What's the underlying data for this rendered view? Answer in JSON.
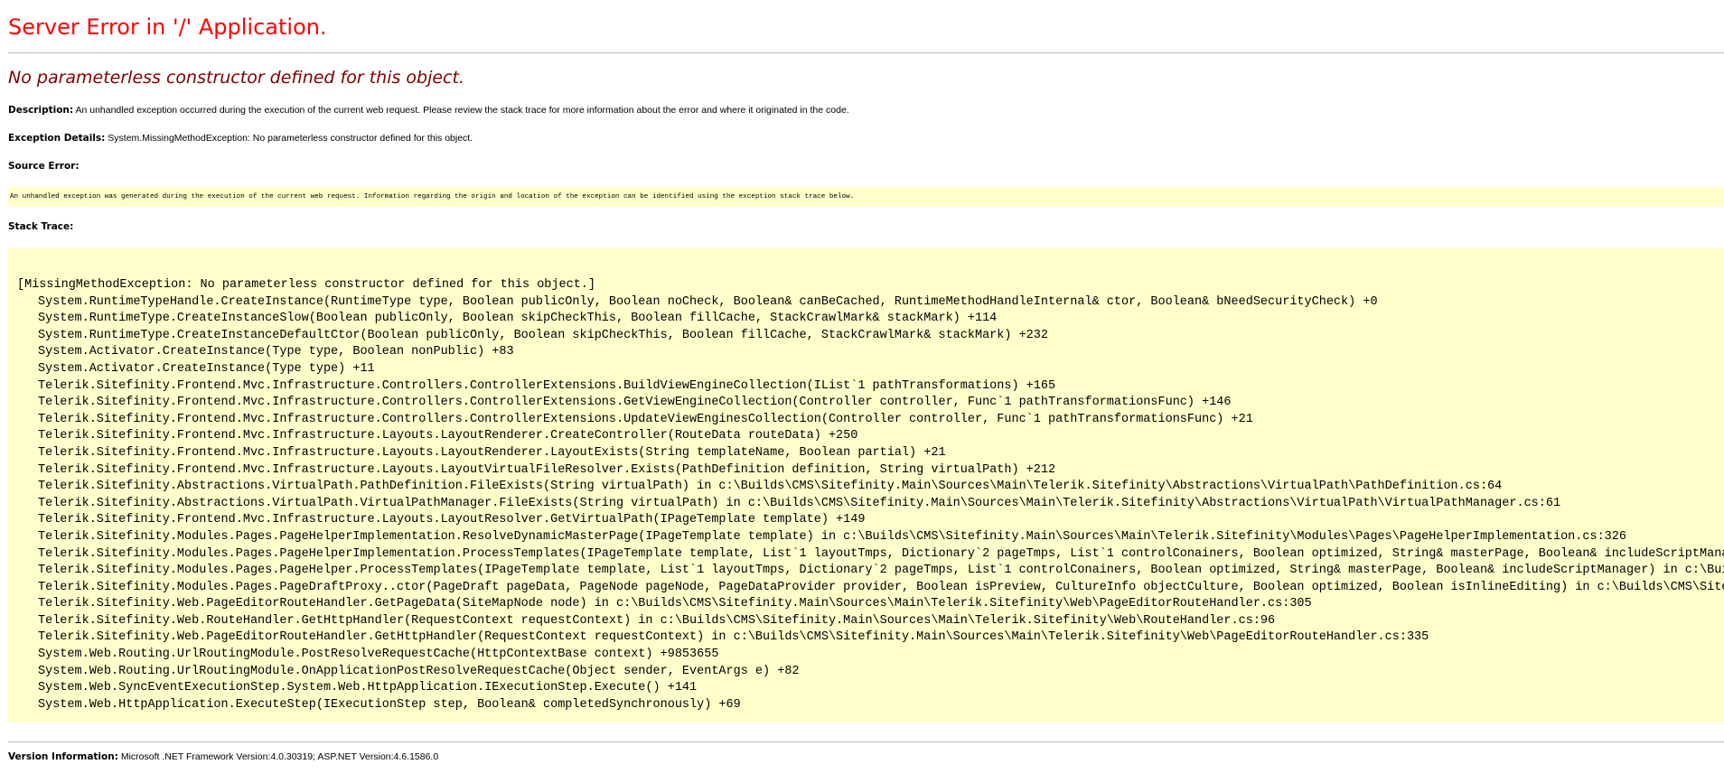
{
  "title": "Server Error in '/' Application.",
  "message": "No parameterless constructor defined for this object.",
  "description": {
    "label": "Description:",
    "text": " An unhandled exception occurred during the execution of the current web request. Please review the stack trace for more information about the error and where it originated in the code."
  },
  "exception_details": {
    "label": "Exception Details:",
    "text": " System.MissingMethodException: No parameterless constructor defined for this object."
  },
  "source_error": {
    "label": "Source Error:",
    "text": "An unhandled exception was generated during the execution of the current web request. Information regarding the origin and location of the exception can be identified using the exception stack trace below."
  },
  "stack_trace": {
    "label": "Stack Trace:",
    "header": "[MissingMethodException: No parameterless constructor defined for this object.]",
    "lines": [
      "System.RuntimeTypeHandle.CreateInstance(RuntimeType type, Boolean publicOnly, Boolean noCheck, Boolean& canBeCached, RuntimeMethodHandleInternal& ctor, Boolean& bNeedSecurityCheck) +0",
      "System.RuntimeType.CreateInstanceSlow(Boolean publicOnly, Boolean skipCheckThis, Boolean fillCache, StackCrawlMark& stackMark) +114",
      "System.RuntimeType.CreateInstanceDefaultCtor(Boolean publicOnly, Boolean skipCheckThis, Boolean fillCache, StackCrawlMark& stackMark) +232",
      "System.Activator.CreateInstance(Type type, Boolean nonPublic) +83",
      "System.Activator.CreateInstance(Type type) +11",
      "Telerik.Sitefinity.Frontend.Mvc.Infrastructure.Controllers.ControllerExtensions.BuildViewEngineCollection(IList`1 pathTransformations) +165",
      "Telerik.Sitefinity.Frontend.Mvc.Infrastructure.Controllers.ControllerExtensions.GetViewEngineCollection(Controller controller, Func`1 pathTransformationsFunc) +146",
      "Telerik.Sitefinity.Frontend.Mvc.Infrastructure.Controllers.ControllerExtensions.UpdateViewEnginesCollection(Controller controller, Func`1 pathTransformationsFunc) +21",
      "Telerik.Sitefinity.Frontend.Mvc.Infrastructure.Layouts.LayoutRenderer.CreateController(RouteData routeData) +250",
      "Telerik.Sitefinity.Frontend.Mvc.Infrastructure.Layouts.LayoutRenderer.LayoutExists(String templateName, Boolean partial) +21",
      "Telerik.Sitefinity.Frontend.Mvc.Infrastructure.Layouts.LayoutVirtualFileResolver.Exists(PathDefinition definition, String virtualPath) +212",
      "Telerik.Sitefinity.Abstractions.VirtualPath.PathDefinition.FileExists(String virtualPath) in c:\\Builds\\CMS\\Sitefinity.Main\\Sources\\Main\\Telerik.Sitefinity\\Abstractions\\VirtualPath\\PathDefinition.cs:64",
      "Telerik.Sitefinity.Abstractions.VirtualPath.VirtualPathManager.FileExists(String virtualPath) in c:\\Builds\\CMS\\Sitefinity.Main\\Sources\\Main\\Telerik.Sitefinity\\Abstractions\\VirtualPath\\VirtualPathManager.cs:61",
      "Telerik.Sitefinity.Frontend.Mvc.Infrastructure.Layouts.LayoutResolver.GetVirtualPath(IPageTemplate template) +149",
      "Telerik.Sitefinity.Modules.Pages.PageHelperImplementation.ResolveDynamicMasterPage(IPageTemplate template) in c:\\Builds\\CMS\\Sitefinity.Main\\Sources\\Main\\Telerik.Sitefinity\\Modules\\Pages\\PageHelperImplementation.cs:326",
      "Telerik.Sitefinity.Modules.Pages.PageHelperImplementation.ProcessTemplates(IPageTemplate template, List`1 layoutTmps, Dictionary`2 pageTmps, List`1 controlConainers, Boolean optimized, String& masterPage, Boolean& includeScriptManager",
      "Telerik.Sitefinity.Modules.Pages.PageHelper.ProcessTemplates(IPageTemplate template, List`1 layoutTmps, Dictionary`2 pageTmps, List`1 controlConainers, Boolean optimized, String& masterPage, Boolean& includeScriptManager) in c:\\Builds",
      "Telerik.Sitefinity.Modules.Pages.PageDraftProxy..ctor(PageDraft pageData, PageNode pageNode, PageDataProvider provider, Boolean isPreview, CultureInfo objectCulture, Boolean optimized, Boolean isInlineEditing) in c:\\Builds\\CMS\\Sitefin",
      "Telerik.Sitefinity.Web.PageEditorRouteHandler.GetPageData(SiteMapNode node) in c:\\Builds\\CMS\\Sitefinity.Main\\Sources\\Main\\Telerik.Sitefinity\\Web\\PageEditorRouteHandler.cs:305",
      "Telerik.Sitefinity.Web.RouteHandler.GetHttpHandler(RequestContext requestContext) in c:\\Builds\\CMS\\Sitefinity.Main\\Sources\\Main\\Telerik.Sitefinity\\Web\\RouteHandler.cs:96",
      "Telerik.Sitefinity.Web.PageEditorRouteHandler.GetHttpHandler(RequestContext requestContext) in c:\\Builds\\CMS\\Sitefinity.Main\\Sources\\Main\\Telerik.Sitefinity\\Web\\PageEditorRouteHandler.cs:335",
      "System.Web.Routing.UrlRoutingModule.PostResolveRequestCache(HttpContextBase context) +9853655",
      "System.Web.Routing.UrlRoutingModule.OnApplicationPostResolveRequestCache(Object sender, EventArgs e) +82",
      "System.Web.SyncEventExecutionStep.System.Web.HttpApplication.IExecutionStep.Execute() +141",
      "System.Web.HttpApplication.ExecuteStep(IExecutionStep step, Boolean& completedSynchronously) +69"
    ]
  },
  "version_info": {
    "label": "Version Information:",
    "text": " Microsoft .NET Framework Version:4.0.30319; ASP.NET Version:4.6.1586.0"
  },
  "colors": {
    "title": "#ff0000",
    "message": "#800000",
    "code_background": "#ffffcc"
  }
}
